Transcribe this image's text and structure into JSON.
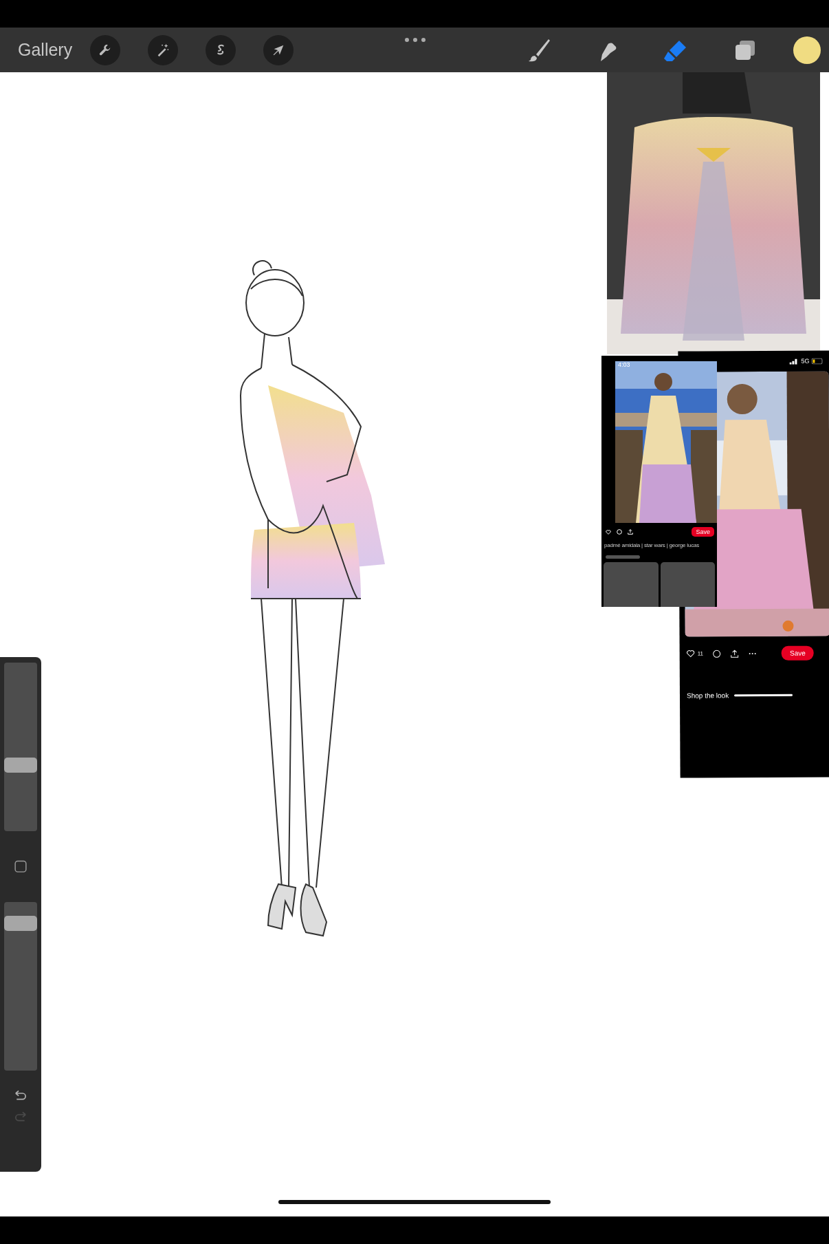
{
  "toolbar": {
    "gallery": "Gallery",
    "actions": [
      {
        "kind": "wrench"
      },
      {
        "kind": "wand"
      },
      {
        "kind": "selection"
      },
      {
        "kind": "arrow"
      }
    ],
    "tools": [
      {
        "kind": "brush",
        "selected": false
      },
      {
        "kind": "smudge",
        "selected": false
      },
      {
        "kind": "eraser",
        "selected": true
      },
      {
        "kind": "layers",
        "selected": false
      }
    ],
    "color": "#f0dc82"
  },
  "sidebar": {
    "size_slider": {
      "level": 0.38
    },
    "opacity_slider": {
      "level": 0.91
    },
    "redo_disabled": true
  },
  "references": {
    "small_screenshot": {
      "time": "4:03",
      "save": "Save",
      "caption": "padmé amidala | star wars | george lucas"
    },
    "large_screenshot": {
      "network": "5G",
      "likes": "11",
      "save": "Save",
      "shop": "Shop the look"
    }
  }
}
